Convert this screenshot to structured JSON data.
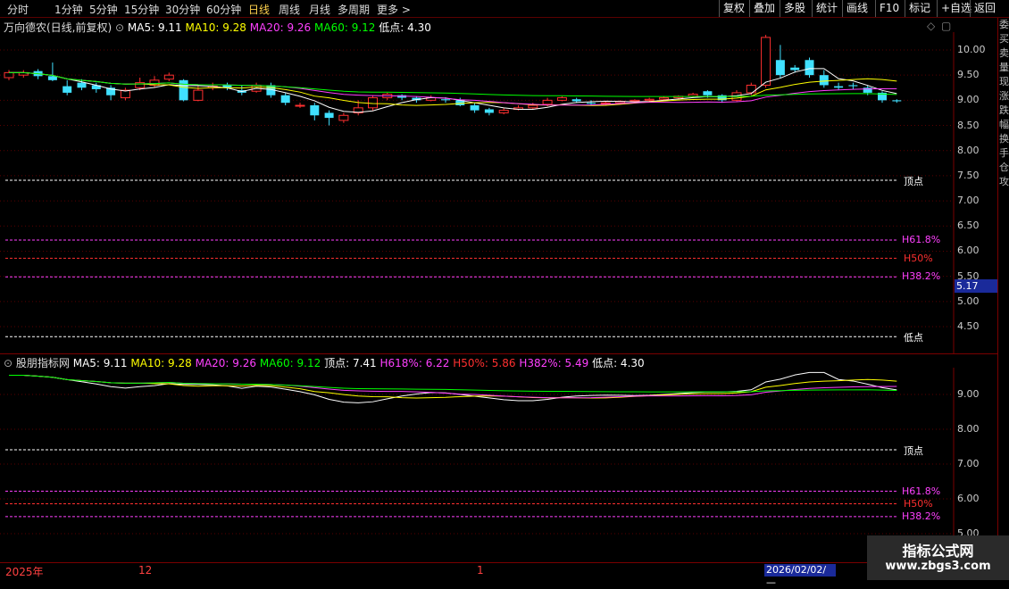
{
  "toolbar": {
    "periods": [
      "分时",
      "1分钟",
      "5分钟",
      "15分钟",
      "30分钟",
      "60分钟",
      "日线",
      "周线",
      "月线",
      "多周期",
      "更多 >"
    ],
    "active_period": "日线",
    "buttons": [
      "复权",
      "叠加",
      "多股",
      "统计",
      "画线",
      "F10",
      "标记",
      "+自选",
      "返回"
    ]
  },
  "main_info": {
    "stock": "万向德农(日线,前复权)",
    "ma5": "MA5: 9.11",
    "ma10": "MA10: 9.28",
    "ma20": "MA20: 9.26",
    "ma60": "MA60: 9.12",
    "low": "低点: 4.30"
  },
  "indicator_info": {
    "name": "股朋指标网",
    "ma5": "MA5: 9.11",
    "ma10": "MA10: 9.28",
    "ma20": "MA20: 9.26",
    "ma60": "MA60: 9.12",
    "top": "顶点: 7.41",
    "h618": "H618%: 6.22",
    "h50": "H50%: 5.86",
    "h382": "H382%: 5.49",
    "low": "低点: 4.30"
  },
  "main_axis": [
    "10.00",
    "9.50",
    "9.00",
    "8.50",
    "8.00",
    "7.50",
    "7.00",
    "6.50",
    "6.00",
    "5.50",
    "5.00",
    "4.50"
  ],
  "sub_axis": [
    "9.00",
    "8.00",
    "7.00",
    "6.00",
    "5.00"
  ],
  "levels": {
    "top": "顶点",
    "h618": "H61.8%",
    "h50": "H50%",
    "h382": "H38.2%",
    "low": "低点"
  },
  "price_tag": "5.17",
  "dates": {
    "year": "2025年",
    "m12": "12",
    "m1": "1",
    "cursor": "2026/02/02/—"
  },
  "watermark": {
    "line1": "指标公式网",
    "line2": "www.zbgs3.com"
  },
  "right_strip": {
    "main": "委买卖量现涨跌幅换手",
    "sub": "仓攻"
  },
  "colors": {
    "ma5": "#ffffff",
    "ma10": "#ffff00",
    "ma20": "#ff40ff",
    "ma60": "#00ff00",
    "up": "#ff3030",
    "down": "#40e0ff",
    "h50": "#ff3030"
  },
  "chart_data": {
    "type": "candlestick",
    "candles": [
      [
        9.45,
        9.55,
        9.6,
        9.4
      ],
      [
        9.5,
        9.55,
        9.6,
        9.45
      ],
      [
        9.58,
        9.48,
        9.62,
        9.42
      ],
      [
        9.48,
        9.4,
        9.75,
        9.38
      ],
      [
        9.28,
        9.15,
        9.4,
        9.1
      ],
      [
        9.35,
        9.25,
        9.42,
        9.2
      ],
      [
        9.3,
        9.22,
        9.35,
        9.15
      ],
      [
        9.25,
        9.1,
        9.3,
        9.0
      ],
      [
        9.05,
        9.2,
        9.25,
        9.0
      ],
      [
        9.25,
        9.35,
        9.45,
        9.2
      ],
      [
        9.3,
        9.4,
        9.48,
        9.25
      ],
      [
        9.42,
        9.5,
        9.55,
        9.38
      ],
      [
        9.4,
        9.0,
        9.42,
        8.98
      ],
      [
        9.0,
        9.2,
        9.3,
        8.98
      ],
      [
        9.25,
        9.28,
        9.35,
        9.2
      ],
      [
        9.3,
        9.25,
        9.35,
        9.2
      ],
      [
        9.2,
        9.15,
        9.3,
        9.1
      ],
      [
        9.18,
        9.3,
        9.35,
        9.15
      ],
      [
        9.3,
        9.1,
        9.35,
        9.05
      ],
      [
        9.1,
        8.95,
        9.15,
        8.9
      ],
      [
        8.9,
        8.9,
        8.95,
        8.85
      ],
      [
        8.9,
        8.7,
        8.95,
        8.6
      ],
      [
        8.75,
        8.65,
        8.8,
        8.5
      ],
      [
        8.6,
        8.7,
        8.75,
        8.55
      ],
      [
        8.75,
        8.85,
        9.0,
        8.7
      ],
      [
        8.85,
        9.05,
        9.1,
        8.8
      ],
      [
        9.05,
        9.12,
        9.15,
        9.0
      ],
      [
        9.1,
        9.05,
        9.12,
        9.0
      ],
      [
        9.05,
        9.0,
        9.08,
        8.95
      ],
      [
        9.0,
        9.05,
        9.1,
        8.98
      ],
      [
        9.02,
        9.0,
        9.06,
        8.95
      ],
      [
        9.0,
        8.9,
        9.05,
        8.88
      ],
      [
        8.9,
        8.8,
        8.95,
        8.75
      ],
      [
        8.82,
        8.75,
        8.85,
        8.7
      ],
      [
        8.75,
        8.8,
        8.85,
        8.72
      ],
      [
        8.82,
        8.85,
        8.9,
        8.8
      ],
      [
        8.85,
        8.9,
        8.95,
        8.82
      ],
      [
        8.92,
        9.0,
        9.05,
        8.88
      ],
      [
        9.0,
        9.05,
        9.08,
        8.98
      ],
      [
        9.02,
        8.98,
        9.05,
        8.95
      ],
      [
        8.95,
        8.93,
        9.0,
        8.9
      ],
      [
        8.94,
        8.95,
        8.98,
        8.9
      ],
      [
        8.95,
        8.98,
        9.0,
        8.92
      ],
      [
        8.98,
        9.0,
        9.02,
        8.95
      ],
      [
        9.0,
        9.02,
        9.05,
        8.98
      ],
      [
        9.02,
        9.05,
        9.08,
        9.0
      ],
      [
        9.05,
        9.08,
        9.1,
        9.02
      ],
      [
        9.08,
        9.12,
        9.15,
        9.05
      ],
      [
        9.18,
        9.1,
        9.2,
        9.05
      ],
      [
        9.1,
        9.0,
        9.12,
        8.95
      ],
      [
        9.0,
        9.15,
        9.2,
        8.98
      ],
      [
        9.15,
        9.3,
        9.35,
        9.1
      ],
      [
        9.3,
        10.25,
        10.3,
        9.25
      ],
      [
        9.8,
        9.5,
        10.1,
        9.45
      ],
      [
        9.65,
        9.6,
        9.7,
        9.55
      ],
      [
        9.8,
        9.5,
        9.85,
        9.45
      ],
      [
        9.5,
        9.3,
        9.6,
        9.25
      ],
      [
        9.28,
        9.25,
        9.35,
        9.2
      ],
      [
        9.3,
        9.28,
        9.35,
        9.22
      ],
      [
        9.25,
        9.15,
        9.3,
        9.1
      ],
      [
        9.15,
        9.0,
        9.18,
        8.95
      ],
      [
        9.0,
        8.98,
        9.02,
        8.95
      ]
    ],
    "ylim": [
      4.0,
      10.5
    ]
  }
}
